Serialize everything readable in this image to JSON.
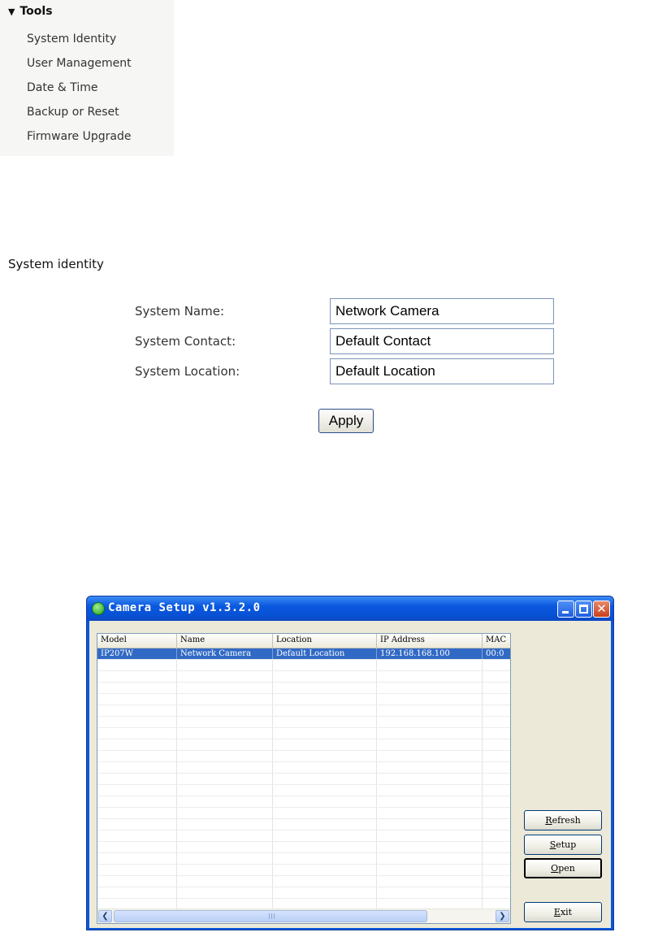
{
  "tools": {
    "header": "Tools",
    "items": [
      {
        "label": "System Identity"
      },
      {
        "label": "User Management"
      },
      {
        "label": "Date & Time"
      },
      {
        "label": "Backup or Reset"
      },
      {
        "label": "Firmware Upgrade"
      }
    ]
  },
  "system_identity": {
    "title": "System identity",
    "fields": [
      {
        "label": "System Name:",
        "value": "Network Camera"
      },
      {
        "label": "System Contact:",
        "value": "Default Contact"
      },
      {
        "label": "System Location:",
        "value": "Default Location"
      }
    ],
    "apply_label": "Apply"
  },
  "camera_setup": {
    "title": "Camera Setup v1.3.2.0",
    "columns": [
      "Model",
      "Name",
      "Location",
      "IP Address",
      "MAC"
    ],
    "rows": [
      {
        "model": "IP207W",
        "name": "Network Camera",
        "location": "Default Location",
        "ip": "192.168.168.100",
        "mac": "00:0"
      }
    ],
    "buttons": {
      "refresh": {
        "mnemonic": "R",
        "rest": "efresh"
      },
      "setup": {
        "mnemonic": "S",
        "rest": "etup"
      },
      "open": {
        "mnemonic": "O",
        "rest": "pen"
      },
      "exit": {
        "mnemonic": "E",
        "rest": "xit"
      }
    }
  }
}
